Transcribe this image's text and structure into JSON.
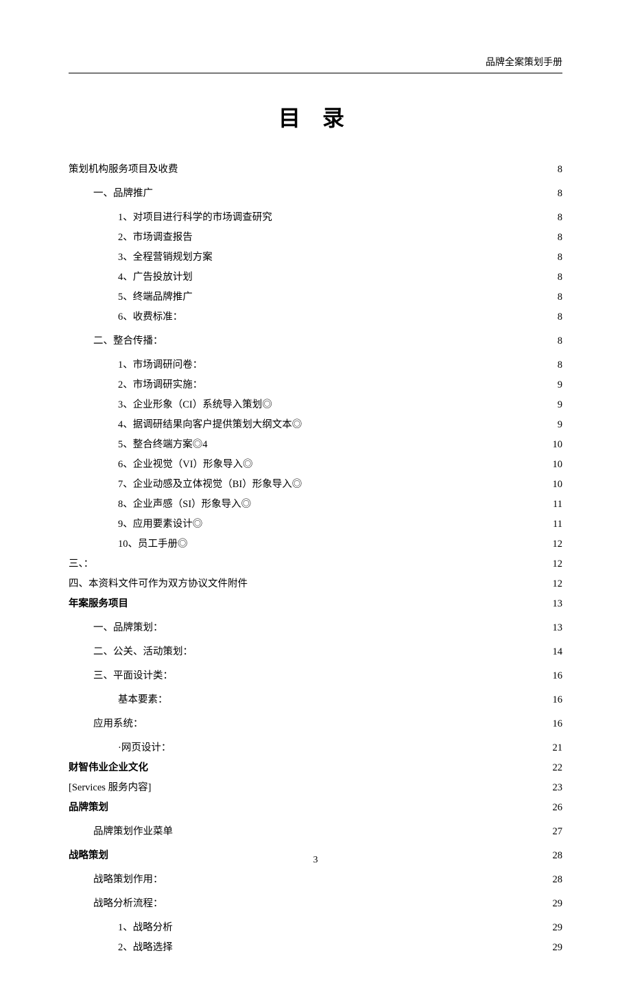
{
  "header": {
    "right_text": "品牌全案策划手册"
  },
  "title": "目 录",
  "toc": [
    {
      "indent": 0,
      "label": "策划机构服务项目及收费",
      "page": "8",
      "bold": false,
      "gap": false
    },
    {
      "indent": 1,
      "label": "一、品牌推广",
      "page": "8",
      "bold": false,
      "gap": true
    },
    {
      "indent": 2,
      "label": "1、对项目进行科学的市场调查研究",
      "page": "8",
      "bold": false,
      "gap": false
    },
    {
      "indent": 2,
      "label": "2、市场调查报告",
      "page": "8",
      "bold": false,
      "gap": false
    },
    {
      "indent": 2,
      "label": "3、全程营销规划方案",
      "page": "8",
      "bold": false,
      "gap": false
    },
    {
      "indent": 2,
      "label": "4、广告投放计划",
      "page": "8",
      "bold": false,
      "gap": false
    },
    {
      "indent": 2,
      "label": "5、终端品牌推广",
      "page": "8",
      "bold": false,
      "gap": false
    },
    {
      "indent": 2,
      "label": "6、收费标准：",
      "page": "8",
      "bold": false,
      "gap": false
    },
    {
      "indent": 1,
      "label": "二、整合传播：",
      "page": "8",
      "bold": false,
      "gap": true
    },
    {
      "indent": 2,
      "label": "1、市场调研问卷：",
      "page": "8",
      "bold": false,
      "gap": false
    },
    {
      "indent": 2,
      "label": "2、市场调研实施：",
      "page": "9",
      "bold": false,
      "gap": false
    },
    {
      "indent": 2,
      "label": "3、企业形象（CI）系统导入策划◎",
      "page": "9",
      "bold": false,
      "gap": false
    },
    {
      "indent": 2,
      "label": "4、据调研结果向客户提供策划大纲文本◎",
      "page": "9",
      "bold": false,
      "gap": false
    },
    {
      "indent": 2,
      "label": "5、整合终端方案◎4",
      "page": "10",
      "bold": false,
      "gap": false
    },
    {
      "indent": 2,
      "label": "6、企业视觉（VI）形象导入◎ ",
      "page": "10",
      "bold": false,
      "gap": false
    },
    {
      "indent": 2,
      "label": "7、企业动感及立体视觉（BI）形象导入◎",
      "page": "10",
      "bold": false,
      "gap": false
    },
    {
      "indent": 2,
      "label": "8、企业声感（SI）形象导入◎ ",
      "page": "11",
      "bold": false,
      "gap": false
    },
    {
      "indent": 2,
      "label": "9、应用要素设计◎ ",
      "page": "11",
      "bold": false,
      "gap": false
    },
    {
      "indent": 2,
      "label": "10、员工手册◎",
      "page": "12",
      "bold": false,
      "gap": false
    },
    {
      "indent": 0,
      "label": "三、：",
      "page": "12",
      "bold": false,
      "gap": false
    },
    {
      "indent": 0,
      "label": "四、本资料文件可作为双方协议文件附件",
      "page": "12",
      "bold": false,
      "gap": false
    },
    {
      "indent": 0,
      "label": "年案服务项目",
      "page": "13",
      "bold": true,
      "gap": false
    },
    {
      "indent": 1,
      "label": "一、品牌策划：",
      "page": "13",
      "bold": false,
      "gap": true
    },
    {
      "indent": 1,
      "label": "二、公关、活动策划：",
      "page": "14",
      "bold": false,
      "gap": true
    },
    {
      "indent": 1,
      "label": "三、平面设计类：",
      "page": "16",
      "bold": false,
      "gap": true
    },
    {
      "indent": 2,
      "label": "基本要素：",
      "page": "16",
      "bold": false,
      "gap": false
    },
    {
      "indent": 1,
      "label": "应用系统：",
      "page": "16",
      "bold": false,
      "gap": true
    },
    {
      "indent": 2,
      "label": "·网页设计：",
      "page": "21",
      "bold": false,
      "gap": false
    },
    {
      "indent": 0,
      "label": "财智伟业企业文化",
      "page": "22",
      "bold": true,
      "gap": false
    },
    {
      "indent": 0,
      "label": "[Services 服务内容] ",
      "page": "23",
      "bold": false,
      "gap": false
    },
    {
      "indent": 0,
      "label": "品牌策划",
      "page": "26",
      "bold": true,
      "gap": false
    },
    {
      "indent": 1,
      "label": "品牌策划作业菜单",
      "page": "27",
      "bold": false,
      "gap": true
    },
    {
      "indent": 0,
      "label": "战略策划",
      "page": "28",
      "bold": true,
      "gap": false
    },
    {
      "indent": 1,
      "label": "战略策划作用：",
      "page": "28",
      "bold": false,
      "gap": true
    },
    {
      "indent": 1,
      "label": "战略分析流程：",
      "page": "29",
      "bold": false,
      "gap": true
    },
    {
      "indent": 2,
      "label": "1、战略分析",
      "page": "29",
      "bold": false,
      "gap": false
    },
    {
      "indent": 2,
      "label": "2、战略选择",
      "page": "29",
      "bold": false,
      "gap": false
    }
  ],
  "footer": {
    "page_number": "3"
  }
}
